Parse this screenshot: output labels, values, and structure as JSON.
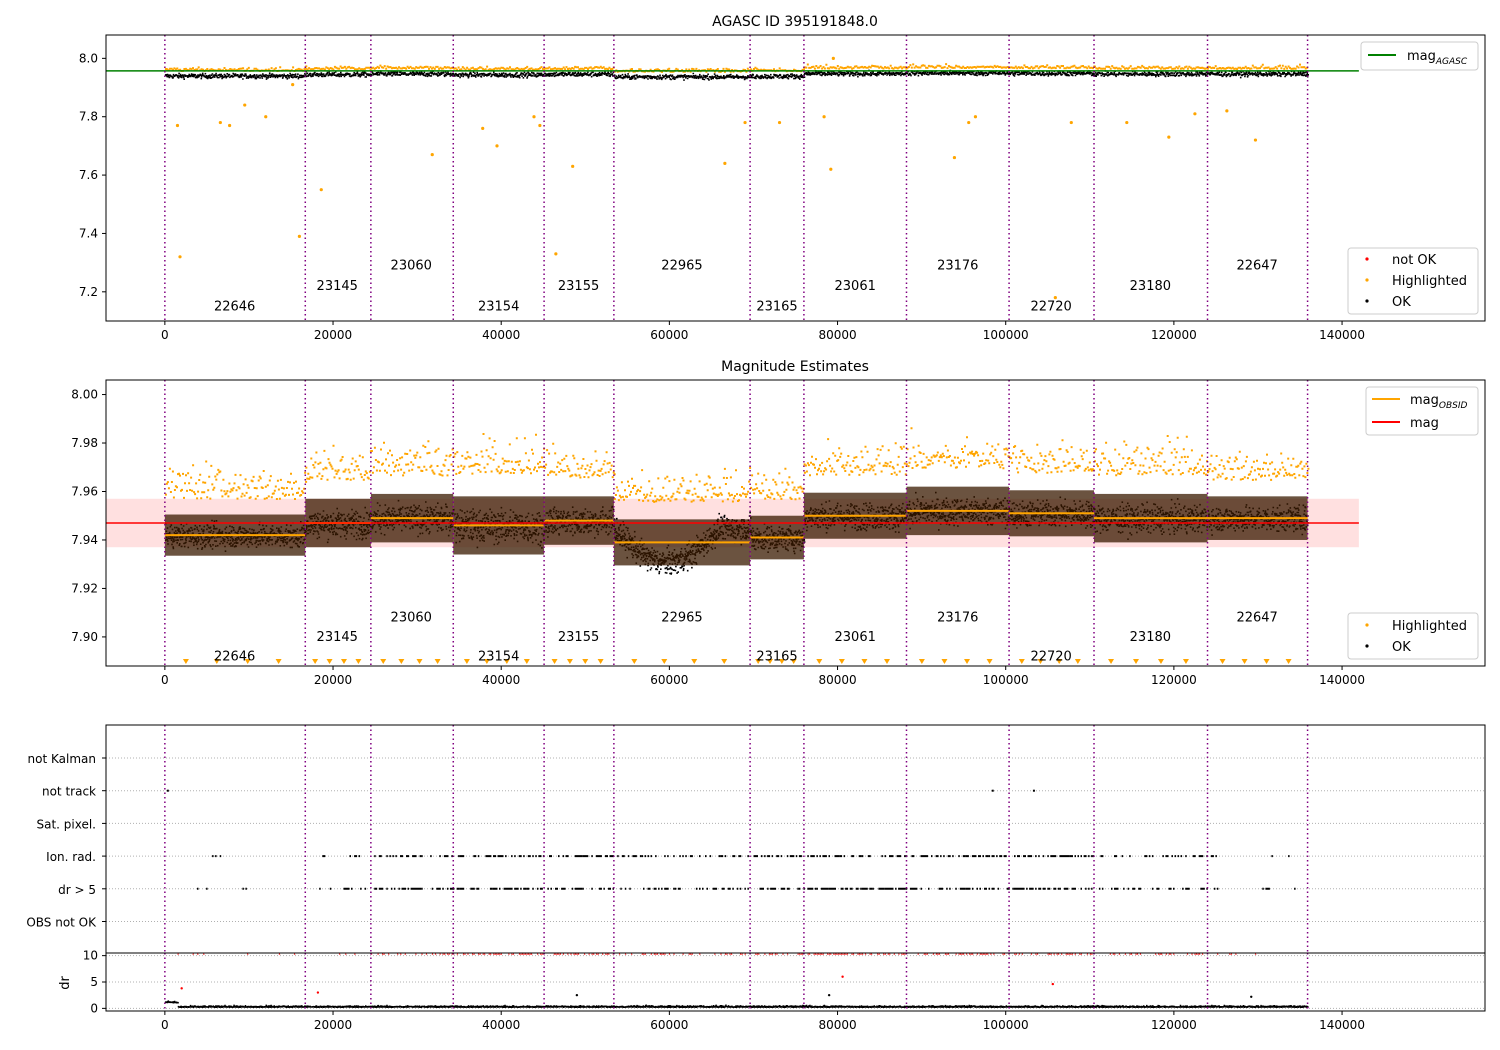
{
  "chart_data": [
    {
      "type": "scatter",
      "title": "AGASC ID 395191848.0",
      "xlim": [
        -7000,
        157000
      ],
      "ylim": [
        7.1,
        8.08
      ],
      "xticks": [
        0,
        20000,
        40000,
        60000,
        80000,
        100000,
        120000,
        140000
      ],
      "xtick_labels": [
        "0",
        "20000",
        "40000",
        "60000",
        "80000",
        "100000",
        "120000",
        "140000"
      ],
      "yticks": [
        7.2,
        7.4,
        7.6,
        7.8,
        8.0
      ],
      "ytick_labels": [
        "7.2",
        "7.4",
        "7.6",
        "7.8",
        "8.0"
      ],
      "obsid_boundaries": [
        0,
        16700,
        24500,
        34300,
        45100,
        53400,
        69600,
        76000,
        88200,
        100400,
        110500,
        124000,
        135900
      ],
      "obsid_labels": [
        {
          "text": "22646",
          "x": 8300,
          "y": 7.15
        },
        {
          "text": "23145",
          "x": 20500,
          "y": 7.22
        },
        {
          "text": "23060",
          "x": 29300,
          "y": 7.29
        },
        {
          "text": "23154",
          "x": 39700,
          "y": 7.15
        },
        {
          "text": "23155",
          "x": 49200,
          "y": 7.22
        },
        {
          "text": "22965",
          "x": 61500,
          "y": 7.29
        },
        {
          "text": "23165",
          "x": 72800,
          "y": 7.15
        },
        {
          "text": "23061",
          "x": 82100,
          "y": 7.22
        },
        {
          "text": "23176",
          "x": 94300,
          "y": 7.29
        },
        {
          "text": "22720",
          "x": 105400,
          "y": 7.15
        },
        {
          "text": "23180",
          "x": 117200,
          "y": 7.22
        },
        {
          "text": "22647",
          "x": 129900,
          "y": 7.29
        }
      ],
      "mag_agasc": 7.957,
      "highlighted_outliers": [
        [
          1800,
          7.32
        ],
        [
          1500,
          7.77
        ],
        [
          7700,
          7.77
        ],
        [
          6600,
          7.78
        ],
        [
          9500,
          7.84
        ],
        [
          12000,
          7.8
        ],
        [
          15200,
          7.91
        ],
        [
          18600,
          7.55
        ],
        [
          16000,
          7.39
        ],
        [
          31800,
          7.67
        ],
        [
          39500,
          7.7
        ],
        [
          37800,
          7.76
        ],
        [
          43900,
          7.8
        ],
        [
          44600,
          7.77
        ],
        [
          46500,
          7.33
        ],
        [
          48500,
          7.63
        ],
        [
          66600,
          7.64
        ],
        [
          69000,
          7.78
        ],
        [
          73100,
          7.78
        ],
        [
          78400,
          7.8
        ],
        [
          79200,
          7.62
        ],
        [
          79500,
          8.0
        ],
        [
          93900,
          7.66
        ],
        [
          95600,
          7.78
        ],
        [
          96400,
          7.8
        ],
        [
          105900,
          7.18
        ],
        [
          107800,
          7.78
        ],
        [
          114400,
          7.78
        ],
        [
          119400,
          7.73
        ],
        [
          122500,
          7.81
        ],
        [
          129700,
          7.72
        ],
        [
          126300,
          7.82
        ]
      ],
      "legend": [
        {
          "label": "mag",
          "sub": "AGASC",
          "color": "#008000",
          "kind": "line"
        },
        {
          "label": "not OK",
          "color": "#ff0000",
          "kind": "point"
        },
        {
          "label": "Highlighted",
          "color": "#ffa500",
          "kind": "point"
        },
        {
          "label": "OK",
          "color": "#000000",
          "kind": "point"
        }
      ]
    },
    {
      "type": "scatter",
      "title": "Magnitude Estimates",
      "xlim": [
        -7000,
        157000
      ],
      "ylim": [
        7.888,
        8.006
      ],
      "xticks": [
        0,
        20000,
        40000,
        60000,
        80000,
        100000,
        120000,
        140000
      ],
      "xtick_labels": [
        "0",
        "20000",
        "40000",
        "60000",
        "80000",
        "100000",
        "120000",
        "140000"
      ],
      "yticks": [
        7.9,
        7.92,
        7.94,
        7.96,
        7.98,
        8.0
      ],
      "ytick_labels": [
        "7.90",
        "7.92",
        "7.94",
        "7.96",
        "7.98",
        "8.00"
      ],
      "obsid_boundaries": [
        0,
        16700,
        24500,
        34300,
        45100,
        53400,
        69600,
        76000,
        88200,
        100400,
        110500,
        124000,
        135900
      ],
      "obsid_labels": [
        {
          "text": "22646",
          "x": 8300,
          "y": 7.892
        },
        {
          "text": "23145",
          "x": 20500,
          "y": 7.9
        },
        {
          "text": "23060",
          "x": 29300,
          "y": 7.908
        },
        {
          "text": "23154",
          "x": 39700,
          "y": 7.892
        },
        {
          "text": "23155",
          "x": 49200,
          "y": 7.9
        },
        {
          "text": "22965",
          "x": 61500,
          "y": 7.908
        },
        {
          "text": "23165",
          "x": 72800,
          "y": 7.892
        },
        {
          "text": "23061",
          "x": 82100,
          "y": 7.9
        },
        {
          "text": "23176",
          "x": 94300,
          "y": 7.908
        },
        {
          "text": "22720",
          "x": 105400,
          "y": 7.892
        },
        {
          "text": "23180",
          "x": 117200,
          "y": 7.9
        },
        {
          "text": "22647",
          "x": 129900,
          "y": 7.908
        }
      ],
      "mag": 7.947,
      "mag_band": [
        7.937,
        7.957
      ],
      "mag_obsid": [
        7.942,
        7.947,
        7.949,
        7.946,
        7.948,
        7.939,
        7.941,
        7.95,
        7.952,
        7.951,
        7.949,
        7.949
      ],
      "obsid_spread": [
        0.0085,
        0.01,
        0.01,
        0.012,
        0.01,
        0.0095,
        0.009,
        0.0095,
        0.01,
        0.0095,
        0.01,
        0.009
      ],
      "legend": [
        {
          "label": "mag",
          "sub": "OBSID",
          "color": "#ffa500",
          "kind": "line"
        },
        {
          "label": "mag",
          "color": "#ff0000",
          "kind": "line"
        },
        {
          "label": "Highlighted",
          "color": "#ffa500",
          "kind": "point"
        },
        {
          "label": "OK",
          "color": "#000000",
          "kind": "point"
        }
      ]
    },
    {
      "type": "scatter",
      "xlim": [
        -7000,
        157000
      ],
      "categories": [
        "not Kalman",
        "not track",
        "Sat. pixel.",
        "Ion. rad.",
        "dr > 5",
        "OBS not OK"
      ],
      "flag_points": {
        "not track": [
          0,
          98100,
          103000
        ]
      },
      "obsid_boundaries": [
        0,
        16700,
        24500,
        34300,
        45100,
        53400,
        69600,
        76000,
        88200,
        100400,
        110500,
        124000,
        135900
      ]
    },
    {
      "type": "scatter",
      "ylabel": "dr",
      "xlim": [
        -7000,
        157000
      ],
      "ylim": [
        -0.5,
        10.5
      ],
      "xticks": [
        0,
        20000,
        40000,
        60000,
        80000,
        100000,
        120000,
        140000
      ],
      "xtick_labels": [
        "0",
        "20000",
        "40000",
        "60000",
        "80000",
        "100000",
        "120000",
        "140000"
      ],
      "yticks": [
        0,
        5,
        10
      ],
      "ytick_labels": [
        "0",
        "5",
        "10"
      ],
      "clip_value": 10,
      "outliers": [
        [
          2000,
          3.8,
          "red"
        ],
        [
          18200,
          3.0,
          "red"
        ],
        [
          80600,
          6.0,
          "red"
        ],
        [
          105600,
          4.6,
          "red"
        ],
        [
          79000,
          2.5,
          "black"
        ],
        [
          49000,
          2.5,
          "black"
        ],
        [
          129200,
          2.2,
          "black"
        ]
      ],
      "obsid_boundaries": [
        0,
        16700,
        24500,
        34300,
        45100,
        53400,
        69600,
        76000,
        88200,
        100400,
        110500,
        124000,
        135900
      ]
    }
  ]
}
